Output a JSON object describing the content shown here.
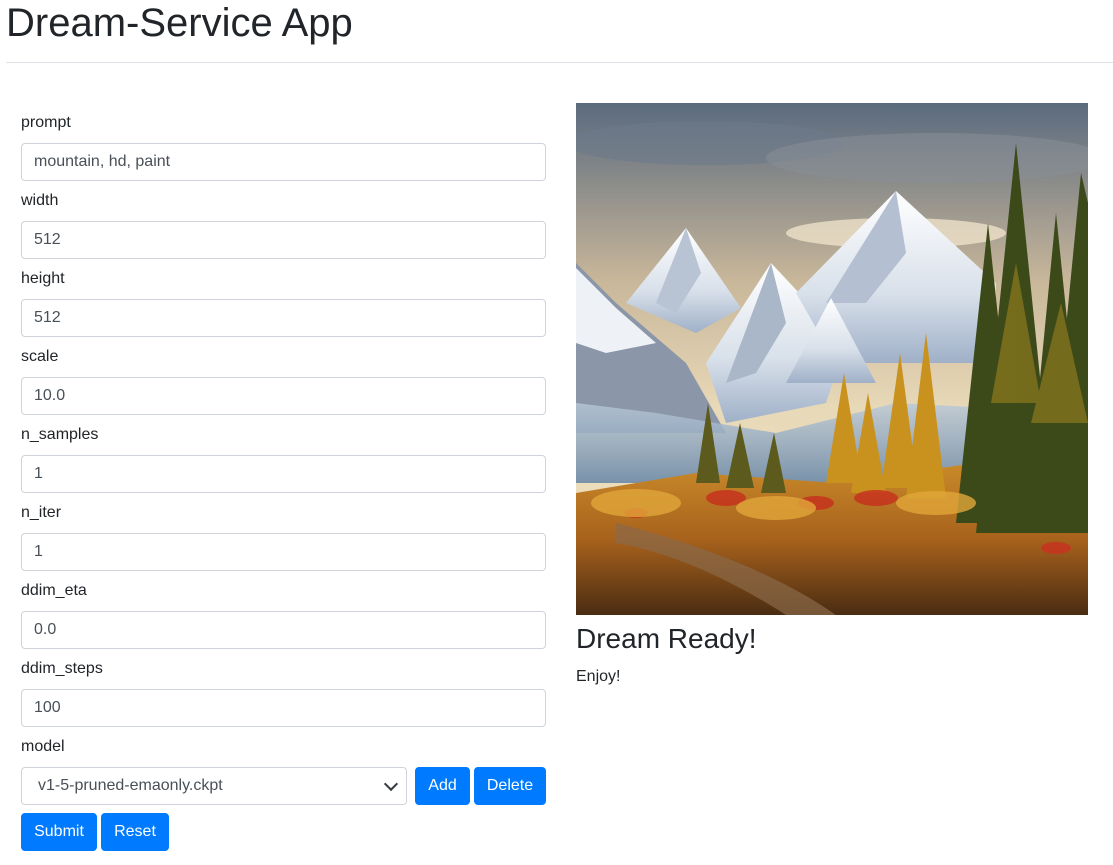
{
  "app": {
    "title": "Dream-Service App"
  },
  "form": {
    "fields": [
      {
        "label": "prompt",
        "value": "mountain, hd, paint"
      },
      {
        "label": "width",
        "value": "512"
      },
      {
        "label": "height",
        "value": "512"
      },
      {
        "label": "scale",
        "value": "10.0"
      },
      {
        "label": "n_samples",
        "value": "1"
      },
      {
        "label": "n_iter",
        "value": "1"
      },
      {
        "label": "ddim_eta",
        "value": "0.0"
      },
      {
        "label": "ddim_steps",
        "value": "100"
      }
    ],
    "model": {
      "label": "model",
      "selected": "v1-5-pruned-emaonly.ckpt"
    },
    "buttons": {
      "add": "Add",
      "delete": "Delete",
      "submit": "Submit",
      "reset": "Reset"
    }
  },
  "result": {
    "heading": "Dream Ready!",
    "message": "Enjoy!"
  },
  "colors": {
    "primary": "#007bff",
    "border": "#ced4da",
    "text": "#212529"
  }
}
